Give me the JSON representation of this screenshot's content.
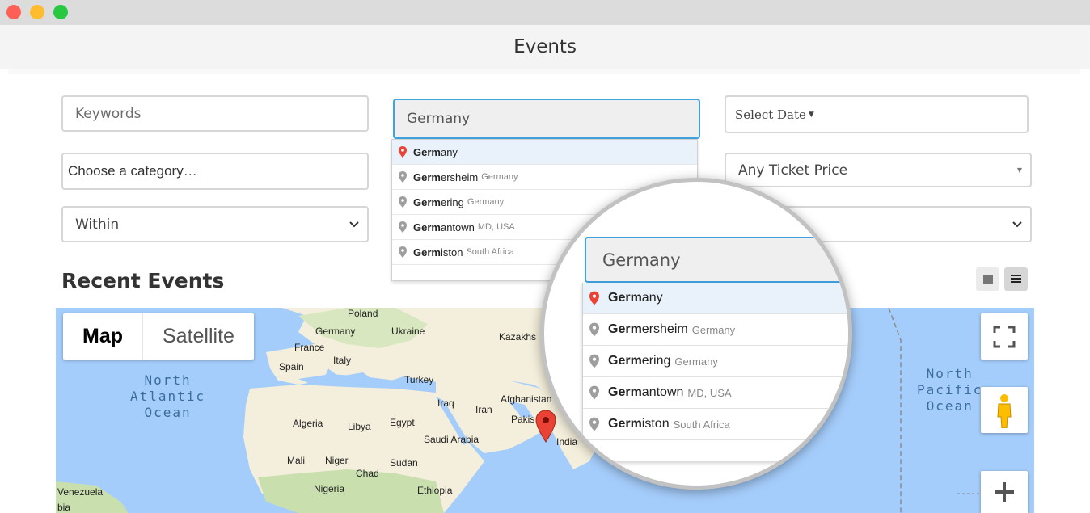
{
  "window": {
    "title": "Events"
  },
  "search": {
    "keywords_placeholder": "Keywords",
    "location_value": "Germany",
    "date_label": "Select Date",
    "category_placeholder": "Choose a category…",
    "ticket_price": "Any Ticket Price",
    "within_label": "Within"
  },
  "suggestions": [
    {
      "match": "Germ",
      "rest": "any",
      "sub": "",
      "primary": true
    },
    {
      "match": "Germ",
      "rest": "ersheim",
      "sub": "Germany",
      "primary": false
    },
    {
      "match": "Germ",
      "rest": "ering",
      "sub": "Germany",
      "primary": false
    },
    {
      "match": "Germ",
      "rest": "antown",
      "sub": "MD, USA",
      "primary": false
    },
    {
      "match": "Germ",
      "rest": "iston",
      "sub": "South Africa",
      "primary": false
    }
  ],
  "recent": {
    "heading": "Recent Events"
  },
  "map": {
    "type_map": "Map",
    "type_satellite": "Satellite",
    "labels": [
      "Poland",
      "Germany",
      "Ukraine",
      "France",
      "Italy",
      "Spain",
      "Turkey",
      "Kazakhs",
      "Afghanistan",
      "Iraq",
      "Iran",
      "Pakis",
      "India",
      "Algeria",
      "Libya",
      "Egypt",
      "Saudi Arabia",
      "Mali",
      "Niger",
      "Sudan",
      "Chad",
      "Nigeria",
      "Ethiopia",
      "Venezuela",
      "bia"
    ],
    "oceans": {
      "atlantic": [
        "North",
        "Atlantic",
        "Ocean"
      ],
      "pacific": [
        "North",
        "Pacific",
        "Ocean"
      ]
    }
  },
  "colors": {
    "accent": "#3fa3de",
    "pin_active": "#ea4335",
    "pin_inactive": "#9e9e9e",
    "land": "#f4efdc",
    "water": "#a5cdfb"
  }
}
